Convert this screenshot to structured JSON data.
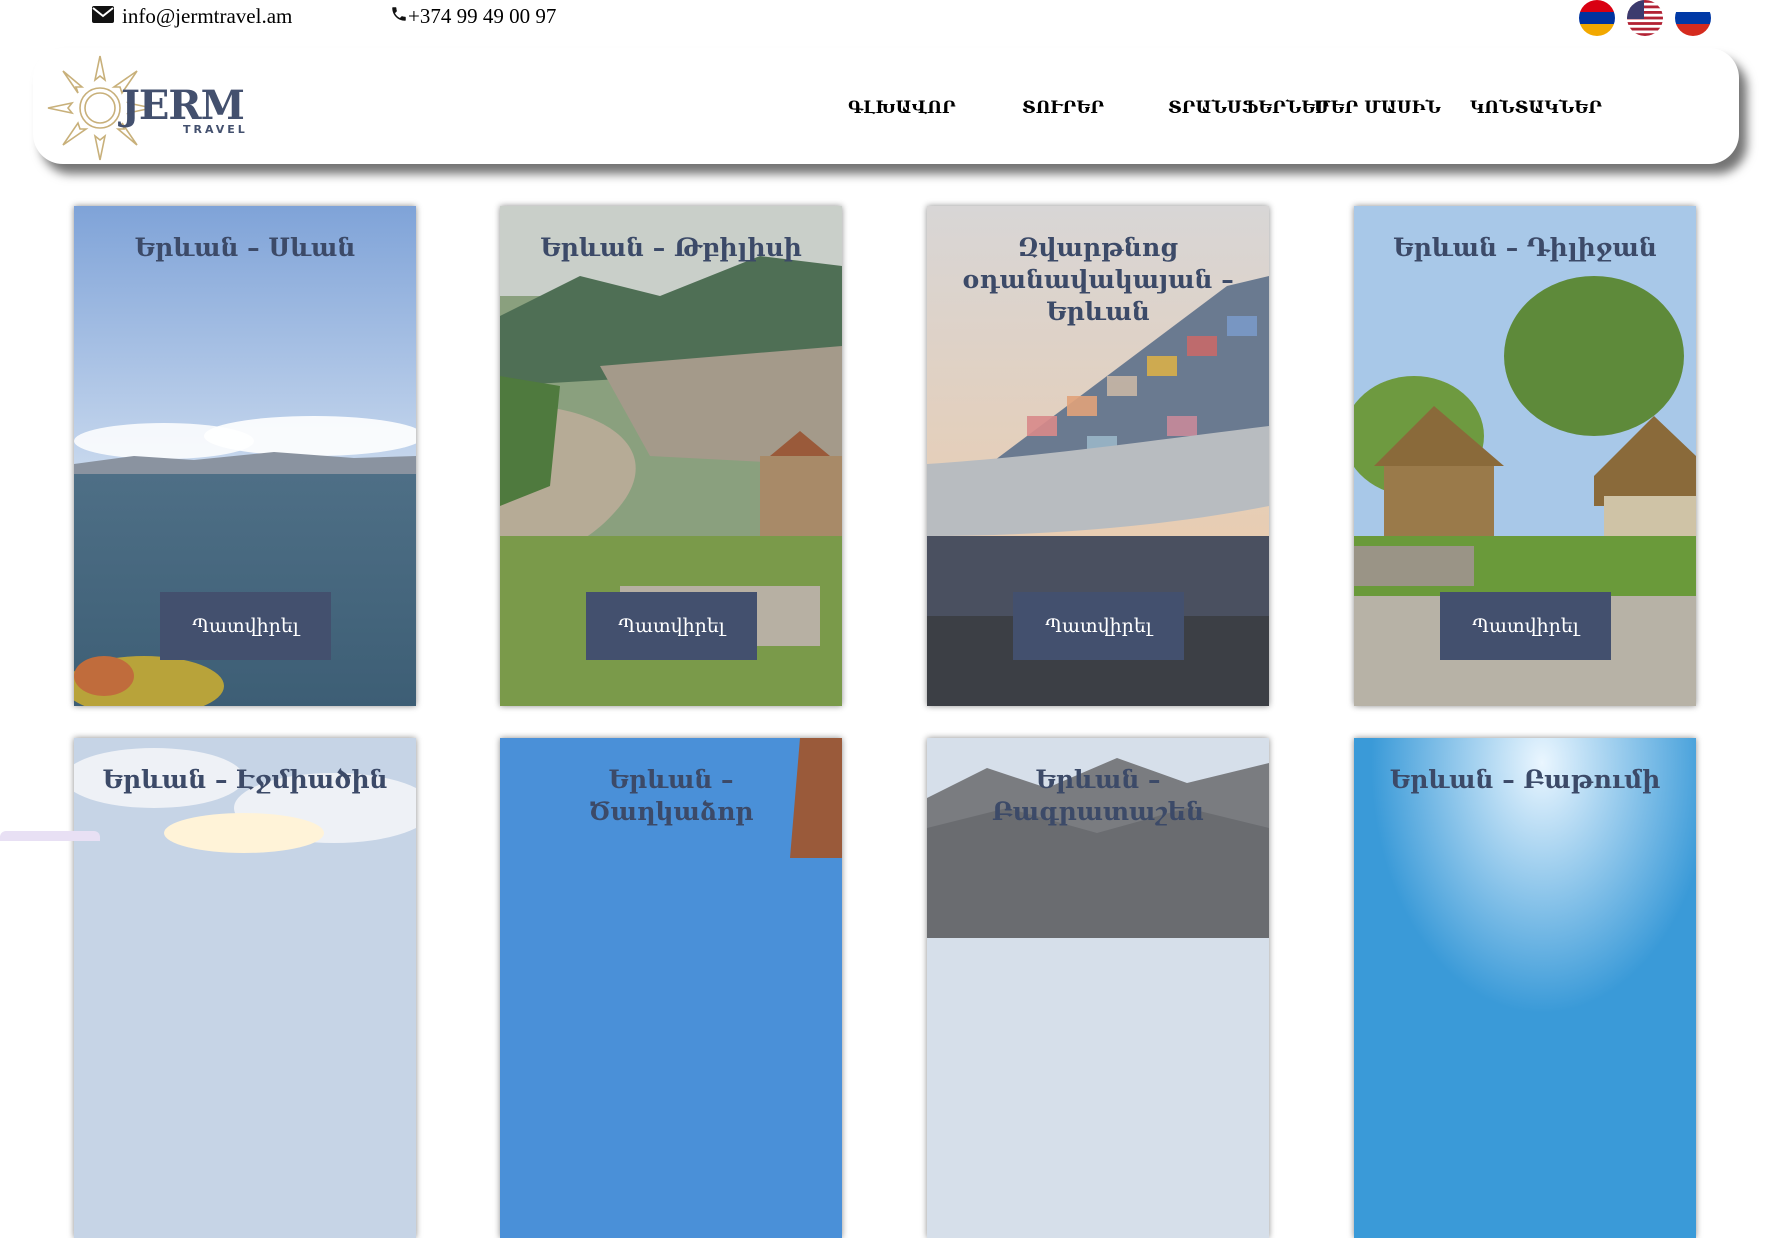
{
  "contact": {
    "email": "info@jermtravel.am",
    "phone": "+374 99 49 00 97"
  },
  "languages": [
    {
      "code": "hy",
      "icon": "flag-armenia-icon"
    },
    {
      "code": "en",
      "icon": "flag-usa-icon"
    },
    {
      "code": "ru",
      "icon": "flag-russia-icon"
    }
  ],
  "logo": {
    "word": "JERM",
    "sub": "TRAVEL"
  },
  "nav": {
    "home": "ԳԼԽԱՎՈՐ",
    "tours": "ՏՈՒՐԵՐ",
    "transfers": "ՏՐԱՆՍՖԵՐՆԵՐ",
    "about": "ՄԵՐ ՄԱՍԻՆ",
    "contacts": "ԿՈՆՏԱԿՆԵՐ"
  },
  "cards": [
    {
      "title": "Երևան – Սևան",
      "button": "Պատվիրել"
    },
    {
      "title": "Երևան – Թբիլիսի",
      "button": "Պատվիրել"
    },
    {
      "title": "Զվարթնոց օդանավակայան – Երևան",
      "button": "Պատվիրել"
    },
    {
      "title": "Երևան – Դիլիջան",
      "button": "Պատվիրել"
    },
    {
      "title": "Երևան – Էջմիածին"
    },
    {
      "title": "Երևան – Ծաղկաձոր"
    },
    {
      "title": "Երևան – Բագրատաշեն"
    },
    {
      "title": "Երևան – Բաթումի"
    }
  ],
  "colors": {
    "accent": "#43506e",
    "title": "#3c4a68"
  }
}
